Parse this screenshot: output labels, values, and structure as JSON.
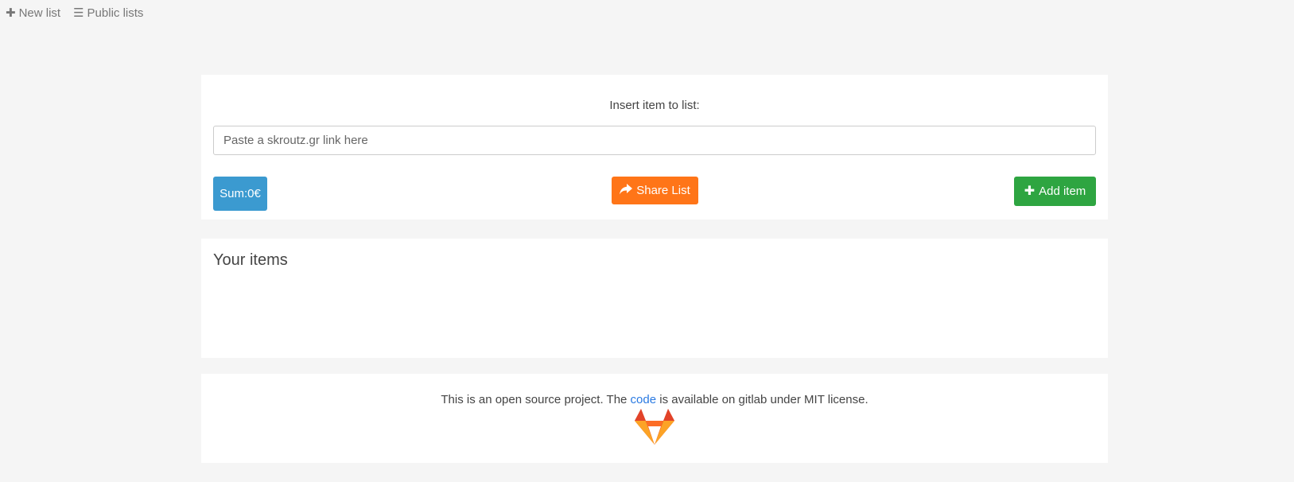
{
  "nav": {
    "new_list": {
      "icon": "plus-icon",
      "label": "New list"
    },
    "public_lists": {
      "icon": "bars-icon",
      "label": "Public lists"
    }
  },
  "insert_panel": {
    "label": "Insert item to list:",
    "input": {
      "value": "",
      "placeholder": "Paste a skroutz.gr link here"
    },
    "sum_button": "Sum:0€",
    "share_button": {
      "icon": "share-icon",
      "label": "Share List"
    },
    "add_button": {
      "icon": "plus-icon",
      "label": "Add item"
    }
  },
  "items_panel": {
    "title": "Your items",
    "items": []
  },
  "footer": {
    "text_before": "This is an open source project. The ",
    "link_text": "code",
    "text_after": " is available on gitlab under MIT license.",
    "logo": "gitlab-logo"
  },
  "colors": {
    "page_bg": "#f5f5f5",
    "sum_button": "#3b9ad0",
    "share_button": "#ff7518",
    "add_button": "#2ea541",
    "link": "#2a7ae2",
    "gitlab_orange": "#e24329"
  }
}
